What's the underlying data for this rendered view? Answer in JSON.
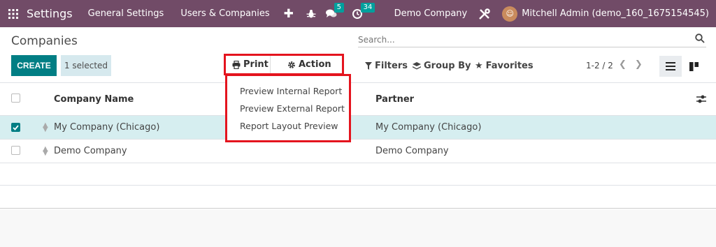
{
  "navbar": {
    "app_name": "Settings",
    "menu": [
      "General Settings",
      "Users & Companies"
    ],
    "messages_count": "5",
    "activities_count": "34",
    "company": "Demo Company",
    "user": "Mitchell Admin (demo_160_1675154545)",
    "accent_color": "#714b67"
  },
  "control": {
    "title": "Companies",
    "search_placeholder": "Search...",
    "create_label": "CREATE",
    "selected_label": "1 selected",
    "print_label": "Print",
    "action_label": "Action",
    "filters_label": "Filters",
    "groupby_label": "Group By",
    "favorites_label": "Favorites",
    "pager": "1-2 / 2"
  },
  "print_menu": [
    "Preview Internal Report",
    "Preview External Report",
    "Report Layout Preview"
  ],
  "table": {
    "headers": {
      "name": "Company Name",
      "partner": "Partner"
    },
    "rows": [
      {
        "name": "My Company (Chicago)",
        "partner": "My Company (Chicago)",
        "selected": true
      },
      {
        "name": "Demo Company",
        "partner": "Demo Company",
        "selected": false
      }
    ]
  }
}
